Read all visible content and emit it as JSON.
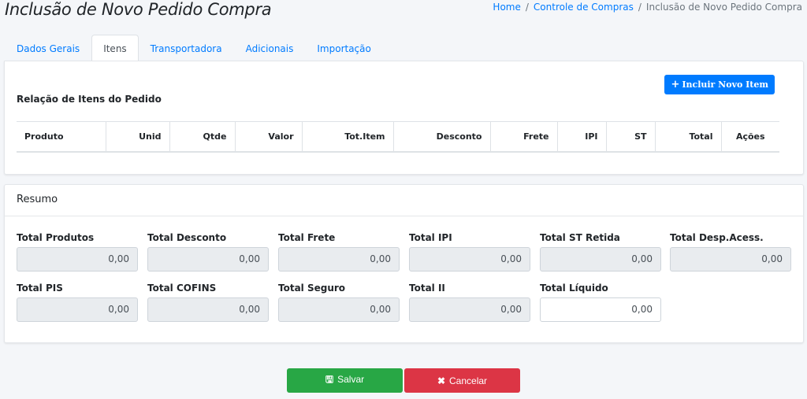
{
  "header": {
    "title": "Inclusão de Novo Pedido Compra",
    "breadcrumb": {
      "home": "Home",
      "separator": "/",
      "controle": "Controle de Compras",
      "current": "Inclusão de Novo Pedido Compra"
    }
  },
  "tabs": [
    "Dados Gerais",
    "Itens",
    "Transportadora",
    "Adicionais",
    "Importação"
  ],
  "active_tab": "Itens",
  "itens": {
    "add_button": "Incluir Novo Item",
    "section_title": "Relação de Itens do Pedido",
    "columns": [
      "Produto",
      "Unid",
      "Qtde",
      "Valor",
      "Tot.Item",
      "Desconto",
      "Frete",
      "IPI",
      "ST",
      "Total",
      "Ações"
    ]
  },
  "resumo": {
    "title": "Resumo",
    "fields": [
      {
        "label": "Total Produtos",
        "value": "0,00"
      },
      {
        "label": "Total Desconto",
        "value": "0,00"
      },
      {
        "label": "Total Frete",
        "value": "0,00"
      },
      {
        "label": "Total IPI",
        "value": "0,00"
      },
      {
        "label": "Total ST Retida",
        "value": "0,00"
      },
      {
        "label": "Total Desp.Acess.",
        "value": "0,00"
      },
      {
        "label": "Total PIS",
        "value": "0,00"
      },
      {
        "label": "Total COFINS",
        "value": "0,00"
      },
      {
        "label": "Total Seguro",
        "value": "0,00"
      },
      {
        "label": "Total II",
        "value": "0,00"
      },
      {
        "label": "Total Líquido",
        "value": "0,00"
      }
    ]
  },
  "actions": {
    "save": "Salvar",
    "cancel": "Cancelar"
  },
  "colors": {
    "primary": "#007bff",
    "success": "#28a745",
    "danger": "#dc3545"
  }
}
